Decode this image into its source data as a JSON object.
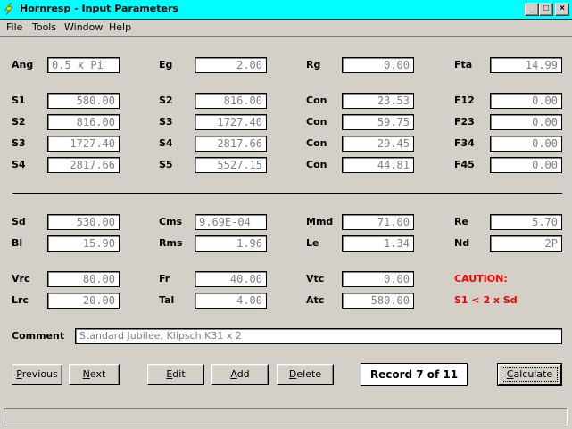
{
  "window": {
    "title": "Hornresp - Input Parameters",
    "controls": {
      "minimize": "_",
      "maximize": "□",
      "close": "×"
    }
  },
  "menu": [
    "File",
    "Tools",
    "Window",
    "Help"
  ],
  "fields": {
    "ang": {
      "label": "Ang",
      "value": "0.5 x Pi"
    },
    "eg": {
      "label": "Eg",
      "value": "2.00"
    },
    "rg": {
      "label": "Rg",
      "value": "0.00"
    },
    "fta": {
      "label": "Fta",
      "value": "14.99"
    },
    "s1_a": {
      "label": "S1",
      "value": "580.00"
    },
    "s2_b": {
      "label": "S2",
      "value": "816.00"
    },
    "con1": {
      "label": "Con",
      "value": "23.53"
    },
    "f12": {
      "label": "F12",
      "value": "0.00"
    },
    "s2_a": {
      "label": "S2",
      "value": "816.00"
    },
    "s3_b": {
      "label": "S3",
      "value": "1727.40"
    },
    "con2": {
      "label": "Con",
      "value": "59.75"
    },
    "f23": {
      "label": "F23",
      "value": "0.00"
    },
    "s3_a": {
      "label": "S3",
      "value": "1727.40"
    },
    "s4_b": {
      "label": "S4",
      "value": "2817.66"
    },
    "con3": {
      "label": "Con",
      "value": "29.45"
    },
    "f34": {
      "label": "F34",
      "value": "0.00"
    },
    "s4_a": {
      "label": "S4",
      "value": "2817.66"
    },
    "s5_b": {
      "label": "S5",
      "value": "5527.15"
    },
    "con4": {
      "label": "Con",
      "value": "44.81"
    },
    "f45": {
      "label": "F45",
      "value": "0.00"
    },
    "sd": {
      "label": "Sd",
      "value": "530.00"
    },
    "cms": {
      "label": "Cms",
      "value": "9.69E-04"
    },
    "mmd": {
      "label": "Mmd",
      "value": "71.00"
    },
    "re": {
      "label": "Re",
      "value": "5.70"
    },
    "bl": {
      "label": "Bl",
      "value": "15.90"
    },
    "rms": {
      "label": "Rms",
      "value": "1.96"
    },
    "le": {
      "label": "Le",
      "value": "1.34"
    },
    "nd": {
      "label": "Nd",
      "value": "2P"
    },
    "vrc": {
      "label": "Vrc",
      "value": "80.00"
    },
    "fr": {
      "label": "Fr",
      "value": "40.00"
    },
    "vtc": {
      "label": "Vtc",
      "value": "0.00"
    },
    "lrc": {
      "label": "Lrc",
      "value": "20.00"
    },
    "tal": {
      "label": "Tal",
      "value": "4.00"
    },
    "atc": {
      "label": "Atc",
      "value": "580.00"
    }
  },
  "caution": {
    "title": "CAUTION:",
    "message": "S1 < 2 x Sd"
  },
  "comment": {
    "label": "Comment",
    "value": "Standard Jubilee; Klipsch K31 x 2"
  },
  "buttons": {
    "previous": {
      "mnemonic": "P",
      "rest": "revious"
    },
    "next": {
      "mnemonic": "N",
      "rest": "ext"
    },
    "edit": {
      "mnemonic": "E",
      "rest": "dit"
    },
    "add": {
      "mnemonic": "A",
      "rest": "dd"
    },
    "delete": {
      "mnemonic": "D",
      "rest": "elete"
    },
    "calculate": {
      "mnemonic": "C",
      "rest": "alculate"
    }
  },
  "record": "Record 7 of 11",
  "colors": {
    "titlebar": "#00ffff",
    "window": "#d4d0c8",
    "caution": "#ff0000",
    "field_text": "#808080"
  }
}
